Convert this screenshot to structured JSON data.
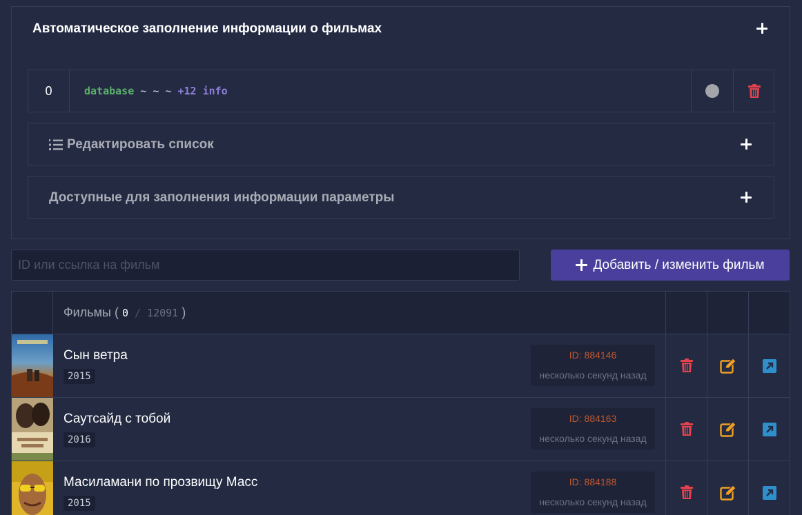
{
  "autofill": {
    "title": "Автоматическое заполнение информации о фильмах",
    "job": {
      "number": "0",
      "source": "database",
      "separator": " ~ ~ ~ ",
      "extra": "+12 info",
      "status_color": "#a3a5ab"
    },
    "edit_list_label": "Редактировать список",
    "params_label": "Доступные для заполнения информации параметры"
  },
  "search": {
    "placeholder": "ID или ссылка на фильм",
    "value": ""
  },
  "add_button_label": "Добавить / изменить фильм",
  "table": {
    "header_label": "Фильмы",
    "open_paren": " ( ",
    "selected_count": "0",
    "slash": " / ",
    "total_count": "12091",
    "close_paren": " )"
  },
  "films": [
    {
      "title": "Сын ветра",
      "year": "2015",
      "id_label": "ID: 884146",
      "updated": "несколько секунд назад"
    },
    {
      "title": "Саутсайд с тобой",
      "year": "2016",
      "id_label": "ID: 884163",
      "updated": "несколько секунд назад"
    },
    {
      "title": "Масиламани по прозвищу Масс",
      "year": "2015",
      "id_label": "ID: 884188",
      "updated": "несколько секунд назад"
    }
  ],
  "colors": {
    "accent": "#4a3f9c",
    "delete": "#e5424d",
    "edit": "#f0a023",
    "open": "#2f8fcb",
    "id_text": "#c0582e"
  },
  "icons": {
    "delete": "trash-icon",
    "edit": "edit-icon",
    "open": "external-link-icon",
    "list": "list-ordered-icon",
    "expand": "plus-icon"
  }
}
